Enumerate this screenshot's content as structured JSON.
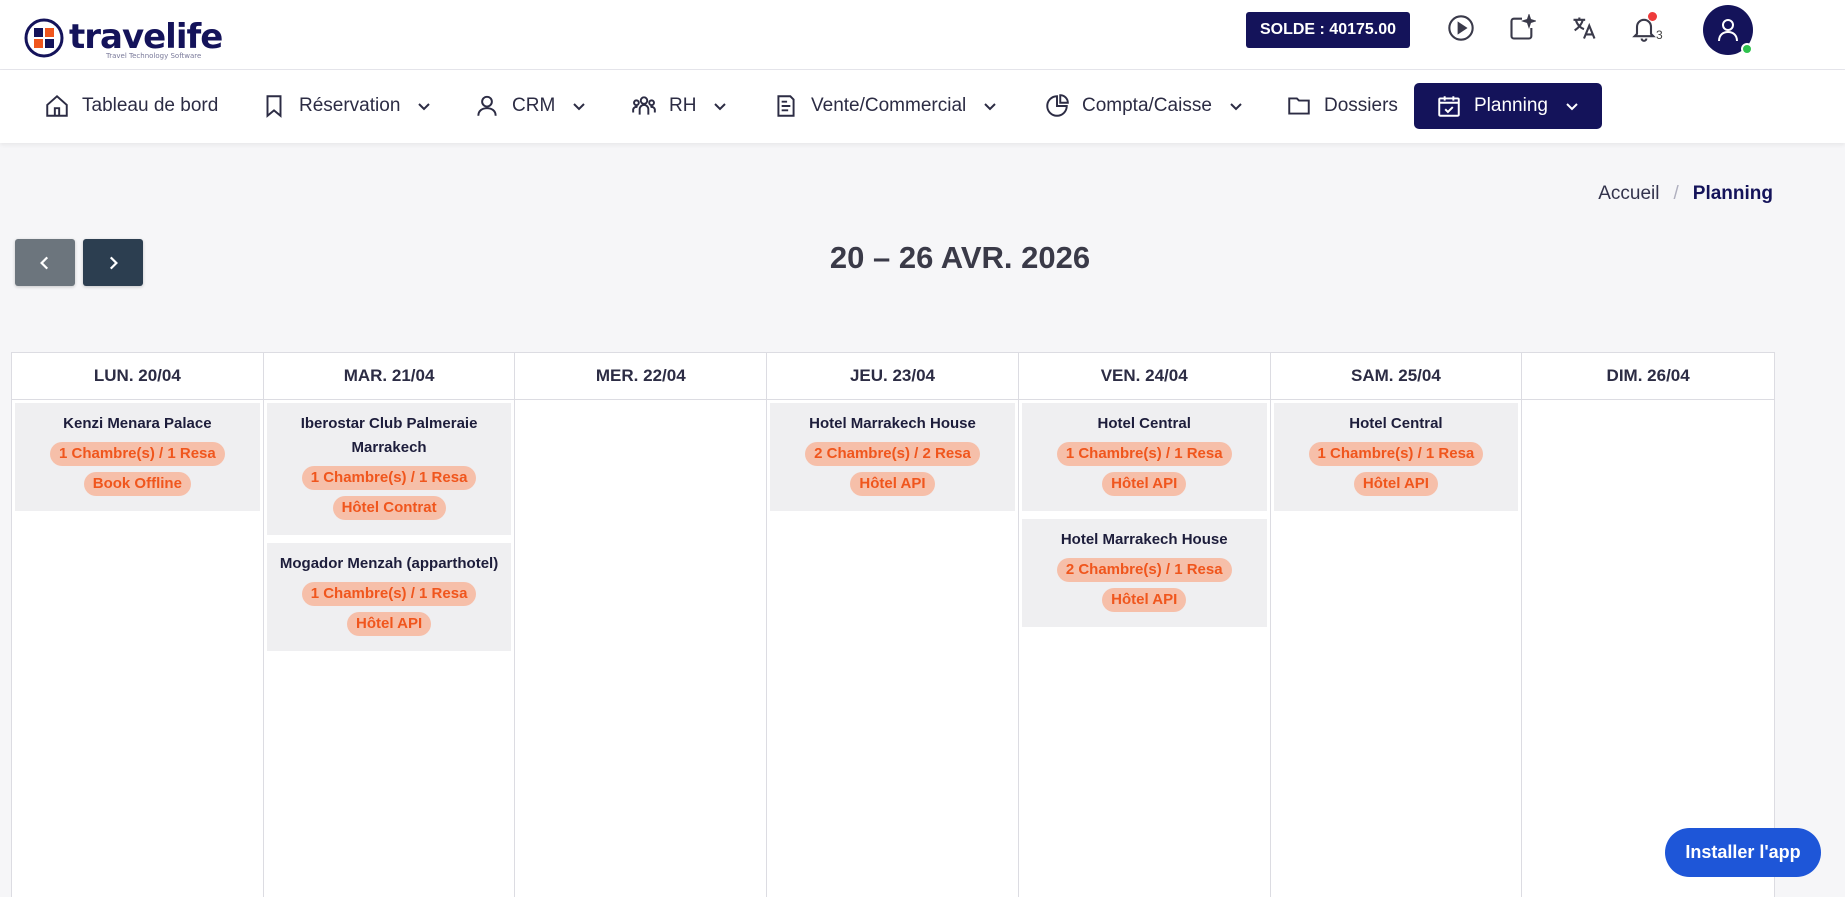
{
  "header": {
    "logo_text": "travelife",
    "logo_tagline": "Travel Technology Software",
    "balance": "SOLDE : 40175.00",
    "notification_count": "3"
  },
  "nav": {
    "items": [
      {
        "label": "Tableau de bord",
        "icon": "home-icon"
      },
      {
        "label": "Réservation",
        "icon": "bookmark-icon"
      },
      {
        "label": "CRM",
        "icon": "user-icon"
      },
      {
        "label": "RH",
        "icon": "users-group-icon"
      },
      {
        "label": "Vente/Commercial",
        "icon": "invoice-icon"
      },
      {
        "label": "Compta/Caisse",
        "icon": "pie-chart-icon"
      },
      {
        "label": "Dossiers",
        "icon": "folder-icon"
      },
      {
        "label": "Planning",
        "icon": "calendar-check-icon"
      }
    ],
    "active": "Planning"
  },
  "breadcrumb": {
    "home": "Accueil",
    "separator": "/",
    "current": "Planning"
  },
  "calendar": {
    "title": "20 – 26 AVR. 2026",
    "days": [
      {
        "label": "LUN. 20/04",
        "events": [
          {
            "name": "Kenzi Menara Palace",
            "rooms": "1 Chambre(s) / 1 Resa",
            "source": "Book Offline"
          }
        ]
      },
      {
        "label": "MAR. 21/04",
        "events": [
          {
            "name": "Iberostar Club Palmeraie Marrakech",
            "rooms": "1 Chambre(s) / 1 Resa",
            "source": "Hôtel Contrat"
          },
          {
            "name": "Mogador Menzah (apparthotel)",
            "rooms": "1 Chambre(s) / 1 Resa",
            "source": "Hôtel API"
          }
        ]
      },
      {
        "label": "MER. 22/04",
        "events": []
      },
      {
        "label": "JEU. 23/04",
        "events": [
          {
            "name": "Hotel Marrakech House",
            "rooms": "2 Chambre(s) / 2 Resa",
            "source": "Hôtel API"
          }
        ]
      },
      {
        "label": "VEN. 24/04",
        "events": [
          {
            "name": "Hotel Central",
            "rooms": "1 Chambre(s) / 1 Resa",
            "source": "Hôtel API"
          },
          {
            "name": "Hotel Marrakech House",
            "rooms": "2 Chambre(s) / 1 Resa",
            "source": "Hôtel API"
          }
        ]
      },
      {
        "label": "SAM. 25/04",
        "events": [
          {
            "name": "Hotel Central",
            "rooms": "1 Chambre(s) / 1 Resa",
            "source": "Hôtel API"
          }
        ]
      },
      {
        "label": "DIM. 26/04",
        "events": []
      }
    ]
  },
  "install_button": "Installer l'app",
  "colors": {
    "brand_navy": "#14135a",
    "pill_bg": "#f6bfa9",
    "pill_text": "#f0561d",
    "install_blue": "#1e56d8"
  }
}
